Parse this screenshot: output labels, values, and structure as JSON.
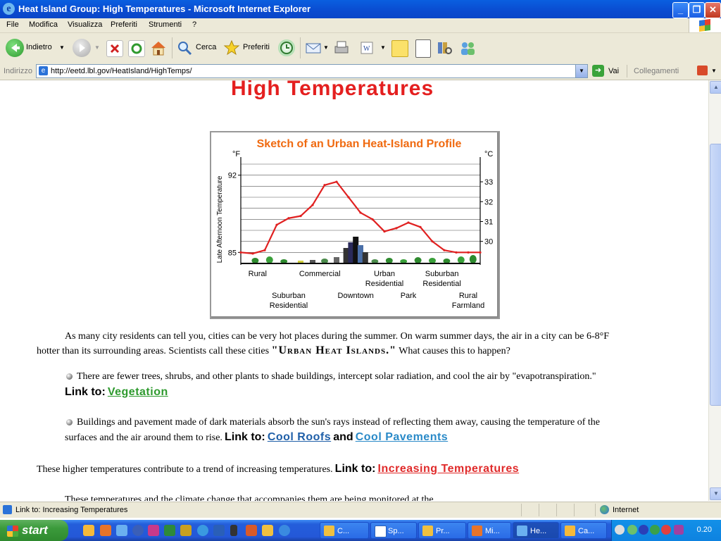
{
  "window": {
    "title": "Heat Island Group: High Temperatures - Microsoft Internet Explorer"
  },
  "menu": [
    "File",
    "Modifica",
    "Visualizza",
    "Preferiti",
    "Strumenti",
    "?"
  ],
  "toolbar": {
    "back_label": "Indietro",
    "search_label": "Cerca",
    "favorites_label": "Preferiti"
  },
  "address": {
    "label": "Indirizzo",
    "url": "http://eetd.lbl.gov/HeatIsland/HighTemps/",
    "go_label": "Vai",
    "links_label": "Collegamenti"
  },
  "page": {
    "title": "High Temperatures",
    "para1_a": "As many city residents can tell you, cities can be very hot places during the summer. On warm summer days, the air in a city can be 6-8°F",
    "para1_b": "hotter than its surrounding areas. Scientists call these cities",
    "para1_em": "\"Urban Heat Islands.\"",
    "para1_c": "What causes this to happen?",
    "bullet1": "There are fewer trees, shrubs, and other plants to shade buildings, intercept solar radiation, and cool the air by \"evapotranspiration.\"",
    "link_to": "Link to:",
    "link_vegetation": "Vegetation",
    "bullet2_a": "Buildings and pavement made of dark materials absorb the sun's rays instead of reflecting them away, causing the temperature of the",
    "bullet2_b": "surfaces and the air around them to rise.",
    "and": "and",
    "link_cool_roofs": "Cool Roofs",
    "link_cool_pavements": "Cool Pavements",
    "para3": "These higher temperatures contribute to a trend of increasing temperatures.",
    "link_increasing": "Increasing Temperatures",
    "para4_partial": "These temperatures and the climate change that accompanies them are being monitored at the"
  },
  "chart_data": {
    "type": "line",
    "title": "Sketch of an Urban Heat-Island Profile",
    "ylabel": "Late Afternoon Temperature",
    "y_unit_left": "°F",
    "y_unit_right": "°C",
    "left_ticks": [
      "92",
      "85"
    ],
    "right_ticks": [
      "33",
      "32",
      "31",
      "30"
    ],
    "ylim": [
      84,
      93
    ],
    "x": [
      0,
      5,
      10,
      15,
      20,
      25,
      30,
      35,
      40,
      45,
      50,
      55,
      60,
      65,
      70,
      75,
      80,
      85,
      90,
      95,
      100
    ],
    "values": [
      85.0,
      84.9,
      85.2,
      87.5,
      88.1,
      88.3,
      89.3,
      91.1,
      91.4,
      90.0,
      88.6,
      88.0,
      86.9,
      87.2,
      87.7,
      87.3,
      86.0,
      85.2,
      85.0,
      85.0,
      85.0
    ],
    "labels_row1": [
      {
        "text": "Rural",
        "pos": 7
      },
      {
        "text": "Commercial",
        "pos": 33
      },
      {
        "text": "Urban\nResidential",
        "pos": 60
      },
      {
        "text": "Suburban\nResidential",
        "pos": 84
      }
    ],
    "labels_row2": [
      {
        "text": "Suburban\nResidential",
        "pos": 20
      },
      {
        "text": "Downtown",
        "pos": 48
      },
      {
        "text": "Park",
        "pos": 70
      },
      {
        "text": "Rural\nFarmland",
        "pos": 95
      }
    ],
    "colors": {
      "title": "#f06a10",
      "line": "#e02020"
    }
  },
  "status": {
    "text": "Link to: Increasing Temperatures",
    "zone": "Internet"
  },
  "taskbar": {
    "start": "start",
    "tasks": [
      "C...",
      "Sp...",
      "Pr...",
      "Mi...",
      "He...",
      "Ca..."
    ],
    "clock": "0.20"
  }
}
